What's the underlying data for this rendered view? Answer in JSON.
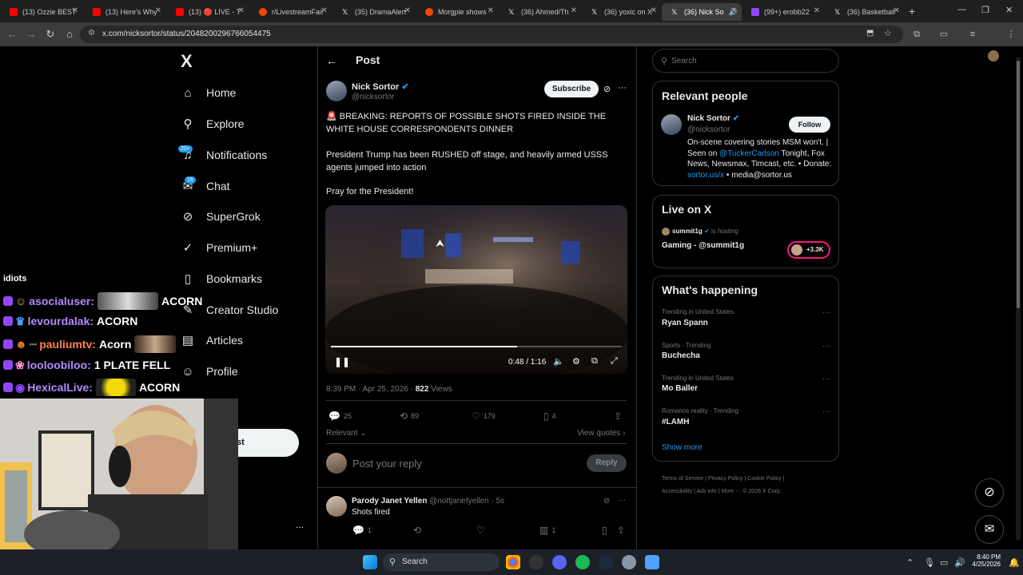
{
  "browser": {
    "tabs": [
      {
        "label": "(13) Ozzie BEST",
        "color": "#ff0000"
      },
      {
        "label": "(13) Here's Why",
        "color": "#ff0000"
      },
      {
        "label": "(13) 🔴 LIVE - T",
        "color": "#ff0000"
      },
      {
        "label": "r/LivestreamFail",
        "color": "#ff4500"
      },
      {
        "label": "(35) DramaAlert",
        "color": "#ffffff"
      },
      {
        "label": "Morgpie shows",
        "color": "#ff4500"
      },
      {
        "label": "(36) Ahmed/Th",
        "color": "#ffffff"
      },
      {
        "label": "(36) yoxic on X",
        "color": "#ffffff"
      },
      {
        "label": "(36) Nick So",
        "color": "#ffffff"
      },
      {
        "label": "(99+) erobb22",
        "color": "#9147ff"
      },
      {
        "label": "(36) Basketball",
        "color": "#ffffff"
      }
    ],
    "url": "x.com/nicksortor/status/2048200296766054475"
  },
  "nav": {
    "logo": "X",
    "items": [
      {
        "label": "Home",
        "icon": "home-icon"
      },
      {
        "label": "Explore",
        "icon": "search-icon"
      },
      {
        "label": "Notifications",
        "icon": "bell-icon",
        "badge": "20+"
      },
      {
        "label": "Chat",
        "icon": "chat-icon",
        "badge": "16"
      },
      {
        "label": "SuperGrok",
        "icon": "grok-icon"
      },
      {
        "label": "Premium+",
        "icon": "premium-icon"
      },
      {
        "label": "Bookmarks",
        "icon": "bookmark-icon"
      },
      {
        "label": "Creator Studio",
        "icon": "creator-icon"
      },
      {
        "label": "Articles",
        "icon": "articles-icon"
      },
      {
        "label": "Profile",
        "icon": "profile-icon"
      }
    ],
    "post_button": "st",
    "more": "..."
  },
  "post": {
    "header": "Post",
    "author_name": "Nick Sortor",
    "author_handle": "@nicksortor",
    "subscribe_label": "Subscribe",
    "text_1": "🚨 BREAKING: REPORTS OF POSSIBLE SHOTS FIRED INSIDE THE WHITE HOUSE CORRESPONDENTS DINNER",
    "text_2": "President Trump has been RUSHED off stage, and heavily armed USSS agents jumped into action",
    "text_3": "Pray for the President!",
    "video_time": "0:48 / 1:16",
    "video_progress": 0.64,
    "timestamp": "8:39 PM · Apr 25, 2026 · ",
    "views_count": "822",
    "views_label": " Views",
    "replies": "25",
    "reposts": "89",
    "likes": "179",
    "bookmarks": "4",
    "sort_label": "Relevant",
    "view_quotes": "View quotes",
    "reply_placeholder": "Post your reply",
    "reply_button": "Reply"
  },
  "reply_item": {
    "name": "Parody Janet Yellen",
    "handle": "@nottjanetyellen · 5s",
    "text": "Shots fired",
    "replies": "1",
    "views": "1"
  },
  "right": {
    "search_placeholder": "Search",
    "relevant_title": "Relevant people",
    "person_name": "Nick Sortor",
    "person_handle": "@nicksortor",
    "follow_label": "Follow",
    "bio_1": "On-scene covering stories MSM won't.",
    "bio_2": "| Seen on ",
    "bio_link_1": "@TuckerCarlson",
    "bio_3": " Tonight, Fox News, Newsmax, Timcast, etc. • Donate: ",
    "bio_link_2": "sortor.us/x",
    "bio_4": " • media@sortor.us",
    "live_title": "Live on X",
    "live_host": "summit1g",
    "live_hosting": "is hosting",
    "live_stream": "Gaming - @summit1g",
    "live_count": "+3.3K",
    "happening_title": "What's happening",
    "trends": [
      {
        "category": "Trending in United States",
        "name": "Ryan Spann"
      },
      {
        "category": "Sports · Trending",
        "name": "Buchecha"
      },
      {
        "category": "Trending in United States",
        "name": "Mo Baller"
      },
      {
        "category": "Romance reality · Trending",
        "name": "#LAMH"
      }
    ],
    "show_more": "Show more",
    "footer_1": "Terms of Service",
    "footer_2": "Privacy Policy",
    "footer_3": "Cookie Policy",
    "footer_4": "Accessibility",
    "footer_5": "Ads info",
    "footer_6": "More ···",
    "footer_7": "© 2026 X Corp."
  },
  "chat": {
    "partial": "idiots",
    "lines": [
      {
        "user": "asocialuser:",
        "msg": "ACORN",
        "color": "#b388ff"
      },
      {
        "user": "levourdalak:",
        "msg": "ACORN",
        "color": "#b388ff"
      },
      {
        "user": "pauliumtv:",
        "msg": "Acorn",
        "color": "#ff7f50"
      },
      {
        "user": "looloobiloo:",
        "msg": "1 PLATE FELL",
        "color": "#b388ff"
      },
      {
        "user": "HexicalLive:",
        "msg": "ACORN",
        "color": "#b388ff"
      }
    ]
  },
  "taskbar": {
    "search": "Search",
    "time": "8:40 PM",
    "date": "4/25/2026"
  }
}
